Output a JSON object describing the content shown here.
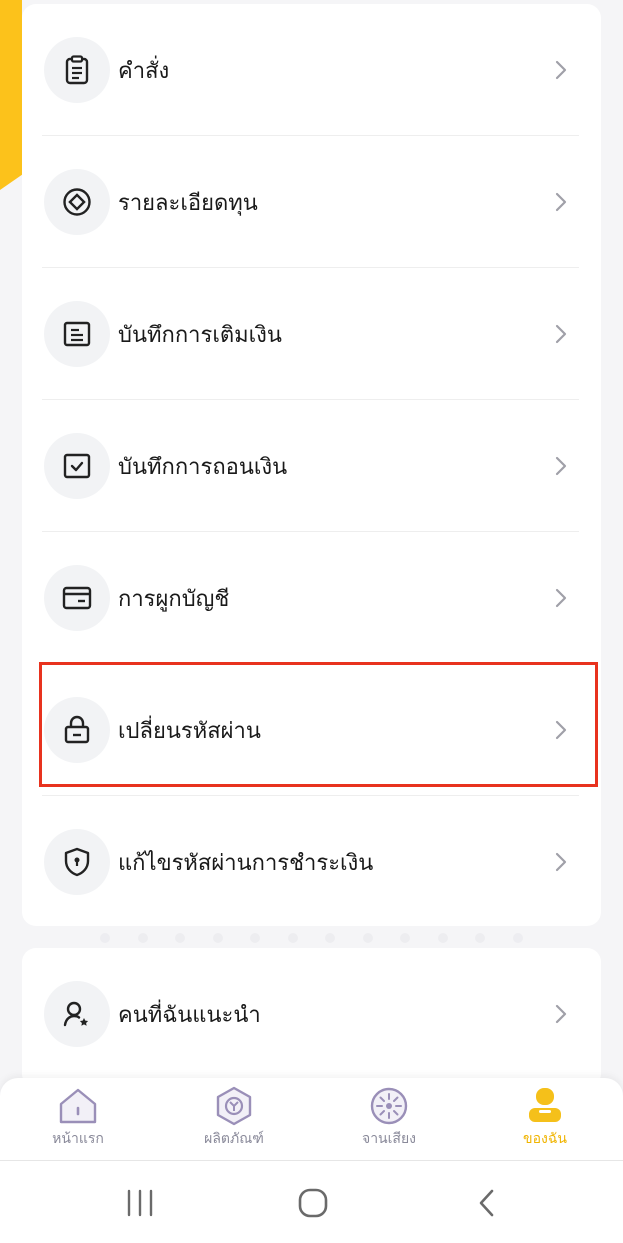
{
  "menu_items": [
    {
      "label": "คำสั่ง",
      "icon": "order-list-icon"
    },
    {
      "label": "รายละเอียดทุน",
      "icon": "fund-details-icon"
    },
    {
      "label": "บันทึกการเติมเงิน",
      "icon": "topup-record-icon"
    },
    {
      "label": "บันทึกการถอนเงิน",
      "icon": "withdrawal-record-icon"
    },
    {
      "label": "การผูกบัญชี",
      "icon": "bank-card-icon"
    },
    {
      "label": "เปลี่ยนรหัสผ่าน",
      "icon": "lock-icon"
    },
    {
      "label": "แก้ไขรหัสผ่านการชำระเงิน",
      "icon": "shield-icon"
    }
  ],
  "second_items": [
    {
      "label": "คนที่ฉันแนะนำ",
      "icon": "referral-user-icon"
    }
  ],
  "bottom_nav": [
    {
      "label": "หน้าแรก",
      "icon": "home-icon"
    },
    {
      "label": "ผลิตภัณฑ์",
      "icon": "product-hexagon-icon"
    },
    {
      "label": "จานเสียง",
      "icon": "spinner-wheel-icon"
    },
    {
      "label": "ของฉัน",
      "icon": "my-profile-icon",
      "active": true
    }
  ],
  "colors": {
    "accent": "#fcc21b",
    "highlight_border": "#e8321e",
    "active_nav": "#f0b400",
    "inactive_nav": "#8a8a9a"
  }
}
